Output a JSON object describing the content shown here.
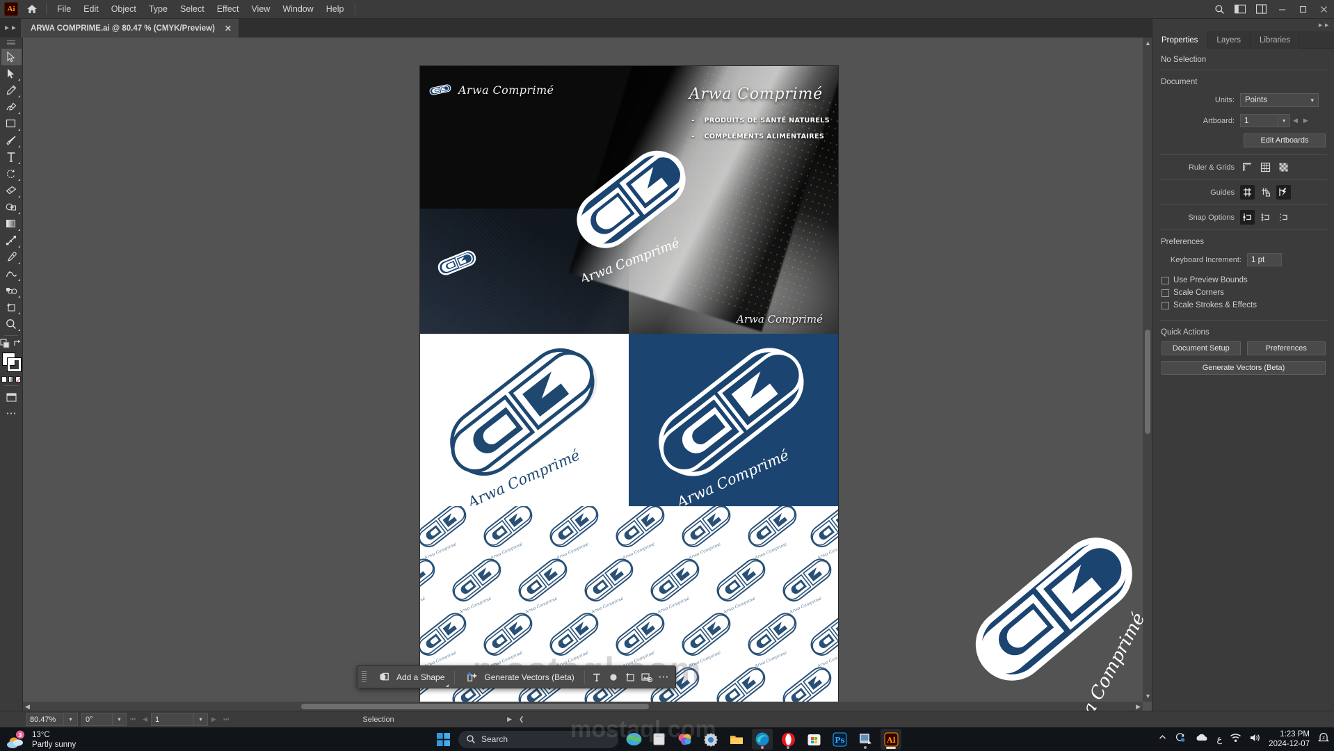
{
  "app": {
    "name": "Adobe Illustrator",
    "logo_text": "Ai"
  },
  "menubar": {
    "items": [
      "File",
      "Edit",
      "Object",
      "Type",
      "Select",
      "Effect",
      "View",
      "Window",
      "Help"
    ],
    "icons": [
      "search-icon",
      "arrange-documents-icon",
      "workspace-switcher-icon"
    ],
    "window_controls": [
      "minimize",
      "maximize",
      "close"
    ]
  },
  "tabbar": {
    "document_tab": "ARWA COMPRIME.ai @ 80.47 % (CMYK/Preview)",
    "close_label": "✕"
  },
  "toolbar": {
    "tools": [
      {
        "name": "selection-tool",
        "selected": true
      },
      {
        "name": "direct-selection-tool",
        "selected": false
      },
      {
        "name": "pen-tool",
        "selected": false
      },
      {
        "name": "curvature-tool",
        "selected": false
      },
      {
        "name": "rectangle-tool",
        "selected": false
      },
      {
        "name": "paintbrush-tool",
        "selected": false
      },
      {
        "name": "type-tool",
        "selected": false
      },
      {
        "name": "rotate-tool",
        "selected": false
      },
      {
        "name": "eraser-tool",
        "selected": false
      },
      {
        "name": "shape-builder-tool",
        "selected": false
      },
      {
        "name": "gradient-tool",
        "selected": false
      },
      {
        "name": "free-transform-tool",
        "selected": false
      },
      {
        "name": "eyedropper-tool",
        "selected": false
      },
      {
        "name": "width-tool",
        "selected": false
      },
      {
        "name": "symbol-sprayer-tool",
        "selected": false
      },
      {
        "name": "artboard-tool",
        "selected": false
      },
      {
        "name": "zoom-tool",
        "selected": false
      }
    ]
  },
  "canvas": {
    "zoom_label": "80.47%",
    "artboard_number": "1"
  },
  "artwork": {
    "brand": "Arwa Comprimé",
    "hero_title": "Arwa Comprimé",
    "hero_header_brand": "Arwa Comprimé",
    "hero_footer_brand": "Arwa Comprimé",
    "bullets": [
      {
        "dash": "-",
        "text": "PRODUITS DE SANTÉ NATURELS"
      },
      {
        "dash": "-",
        "text": "COMPLÉMENTS ALIMENTAIRES"
      }
    ],
    "logo_wordmark": "Arwa Comprimé",
    "colors": {
      "brand_blue": "#1b4470",
      "logo_blue": "#1e4870",
      "white": "#ffffff"
    },
    "watermark": "mostaql.com"
  },
  "context_toolbar": {
    "add_shape": "Add a Shape",
    "generate_vectors": "Generate Vectors (Beta)",
    "icons": [
      "type-icon",
      "artboard-icon",
      "image-insert-icon",
      "more-options-icon"
    ]
  },
  "properties_panel": {
    "tabs": [
      {
        "label": "Properties",
        "active": true
      },
      {
        "label": "Layers",
        "active": false
      },
      {
        "label": "Libraries",
        "active": false
      }
    ],
    "selection_status": "No Selection",
    "document": {
      "title": "Document",
      "units_label": "Units:",
      "units_value": "Points",
      "artboard_label": "Artboard:",
      "artboard_value": "1",
      "edit_artboards": "Edit Artboards"
    },
    "ruler_grids": {
      "label": "Ruler & Grids",
      "icons": [
        "show-rulers-icon",
        "show-grid-icon",
        "show-transparency-grid-icon"
      ]
    },
    "guides": {
      "label": "Guides",
      "icons": [
        "show-guides-icon",
        "lock-guides-icon",
        "smart-guides-icon"
      ],
      "active": [
        0,
        2
      ]
    },
    "snap_options": {
      "label": "Snap Options",
      "icons": [
        "snap-to-point-icon",
        "snap-to-grid-icon",
        "snap-to-pixel-icon"
      ],
      "active": [
        0
      ]
    },
    "preferences": {
      "title": "Preferences",
      "keyboard_increment_label": "Keyboard Increment:",
      "keyboard_increment_value": "1 pt",
      "checkboxes": [
        {
          "label": "Use Preview Bounds",
          "checked": false
        },
        {
          "label": "Scale Corners",
          "checked": false
        },
        {
          "label": "Scale Strokes & Effects",
          "checked": false
        }
      ]
    },
    "quick_actions": {
      "title": "Quick Actions",
      "document_setup": "Document Setup",
      "preferences": "Preferences",
      "generate_vectors": "Generate Vectors (Beta)"
    }
  },
  "statusbar": {
    "zoom": "80.47%",
    "rotation": "0°",
    "artboard": "1",
    "tool_status": "Selection"
  },
  "taskbar": {
    "weather_temp": "13°C",
    "weather_desc": "Partly sunny",
    "weather_badge": "3",
    "search_placeholder": "Search",
    "apps": [
      {
        "name": "start-button"
      },
      {
        "name": "search-box"
      },
      {
        "name": "widgets-earth-icon"
      },
      {
        "name": "file-explorer-icon"
      },
      {
        "name": "photos-icon"
      },
      {
        "name": "settings-icon"
      },
      {
        "name": "folder-icon"
      },
      {
        "name": "edge-browser-icon"
      },
      {
        "name": "opera-browser-icon"
      },
      {
        "name": "microsoft-store-icon"
      },
      {
        "name": "photoshop-icon"
      },
      {
        "name": "capture-icon"
      },
      {
        "name": "illustrator-icon"
      }
    ],
    "tray": {
      "time": "1:23 PM",
      "date": "2024-12-07",
      "language": "ع",
      "icons": [
        "chevron-up-icon",
        "sync-icon",
        "onedrive-icon",
        "language-icon",
        "wifi-icon",
        "volume-icon",
        "notifications-icon"
      ]
    },
    "watermark": "mostaql.com"
  }
}
